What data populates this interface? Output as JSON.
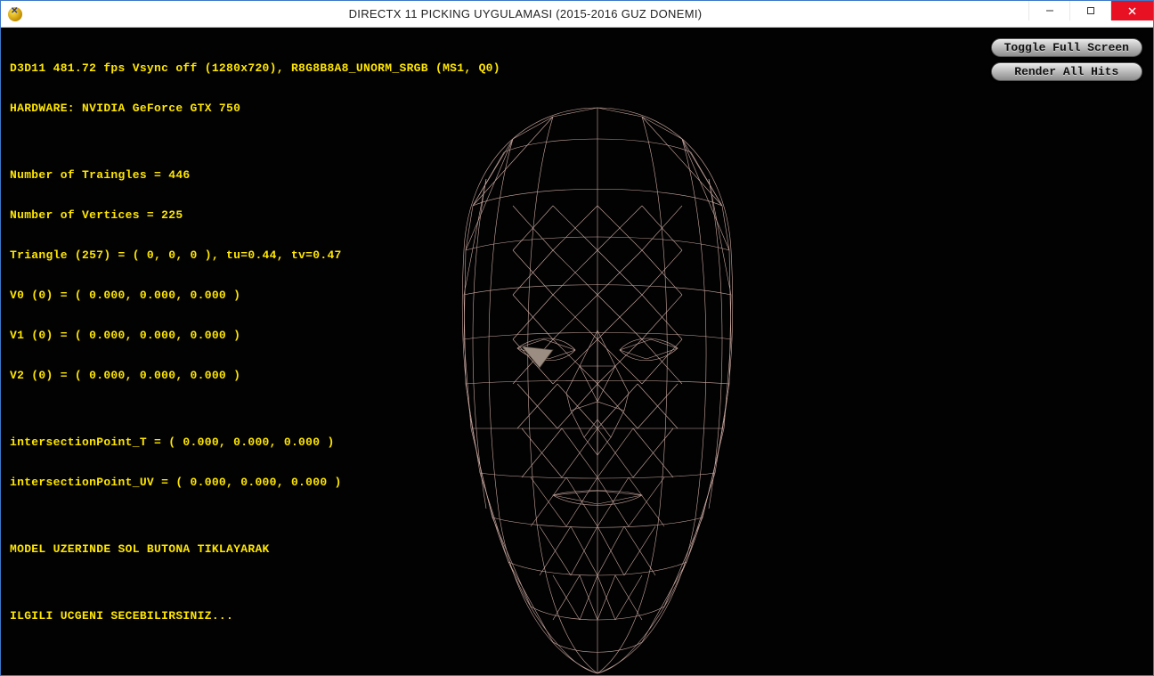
{
  "window": {
    "title": "DIRECTX 11 PICKING UYGULAMASI (2015-2016 GUZ DONEMI)"
  },
  "win_controls": {
    "minimize_glyph": "—",
    "maximize_glyph": "▢",
    "close_glyph": "✕"
  },
  "debug": {
    "line1": "D3D11 481.72 fps Vsync off (1280x720), R8G8B8A8_UNORM_SRGB (MS1, Q0)",
    "line2": "HARDWARE: NVIDIA GeForce GTX 750",
    "blank1": "",
    "line3": "Number of Traingles = 446",
    "line4": "Number of Vertices = 225",
    "line5": "Triangle (257) = ( 0, 0, 0 ), tu=0.44, tv=0.47",
    "line6": "V0 (0) = ( 0.000, 0.000, 0.000 )",
    "line7": "V1 (0) = ( 0.000, 0.000, 0.000 )",
    "line8": "V2 (0) = ( 0.000, 0.000, 0.000 )",
    "blank2": "",
    "line9": "intersectionPoint_T = ( 0.000, 0.000, 0.000 )",
    "line10": "intersectionPoint_UV = ( 0.000, 0.000, 0.000 )",
    "blank3": "",
    "line11": "MODEL UZERINDE SOL BUTONA TIKLAYARAK",
    "blank4": "",
    "line12": "ILGILI UCGENI SECEBILIRSINIZ..."
  },
  "buttons": {
    "toggle_full_screen": "Toggle Full Screen",
    "render_all_hits": "Render All Hits"
  },
  "colors": {
    "debug_text": "#ffe600",
    "viewport_bg": "#020202",
    "wire": "#caa8a0",
    "close_btn": "#e81123"
  }
}
